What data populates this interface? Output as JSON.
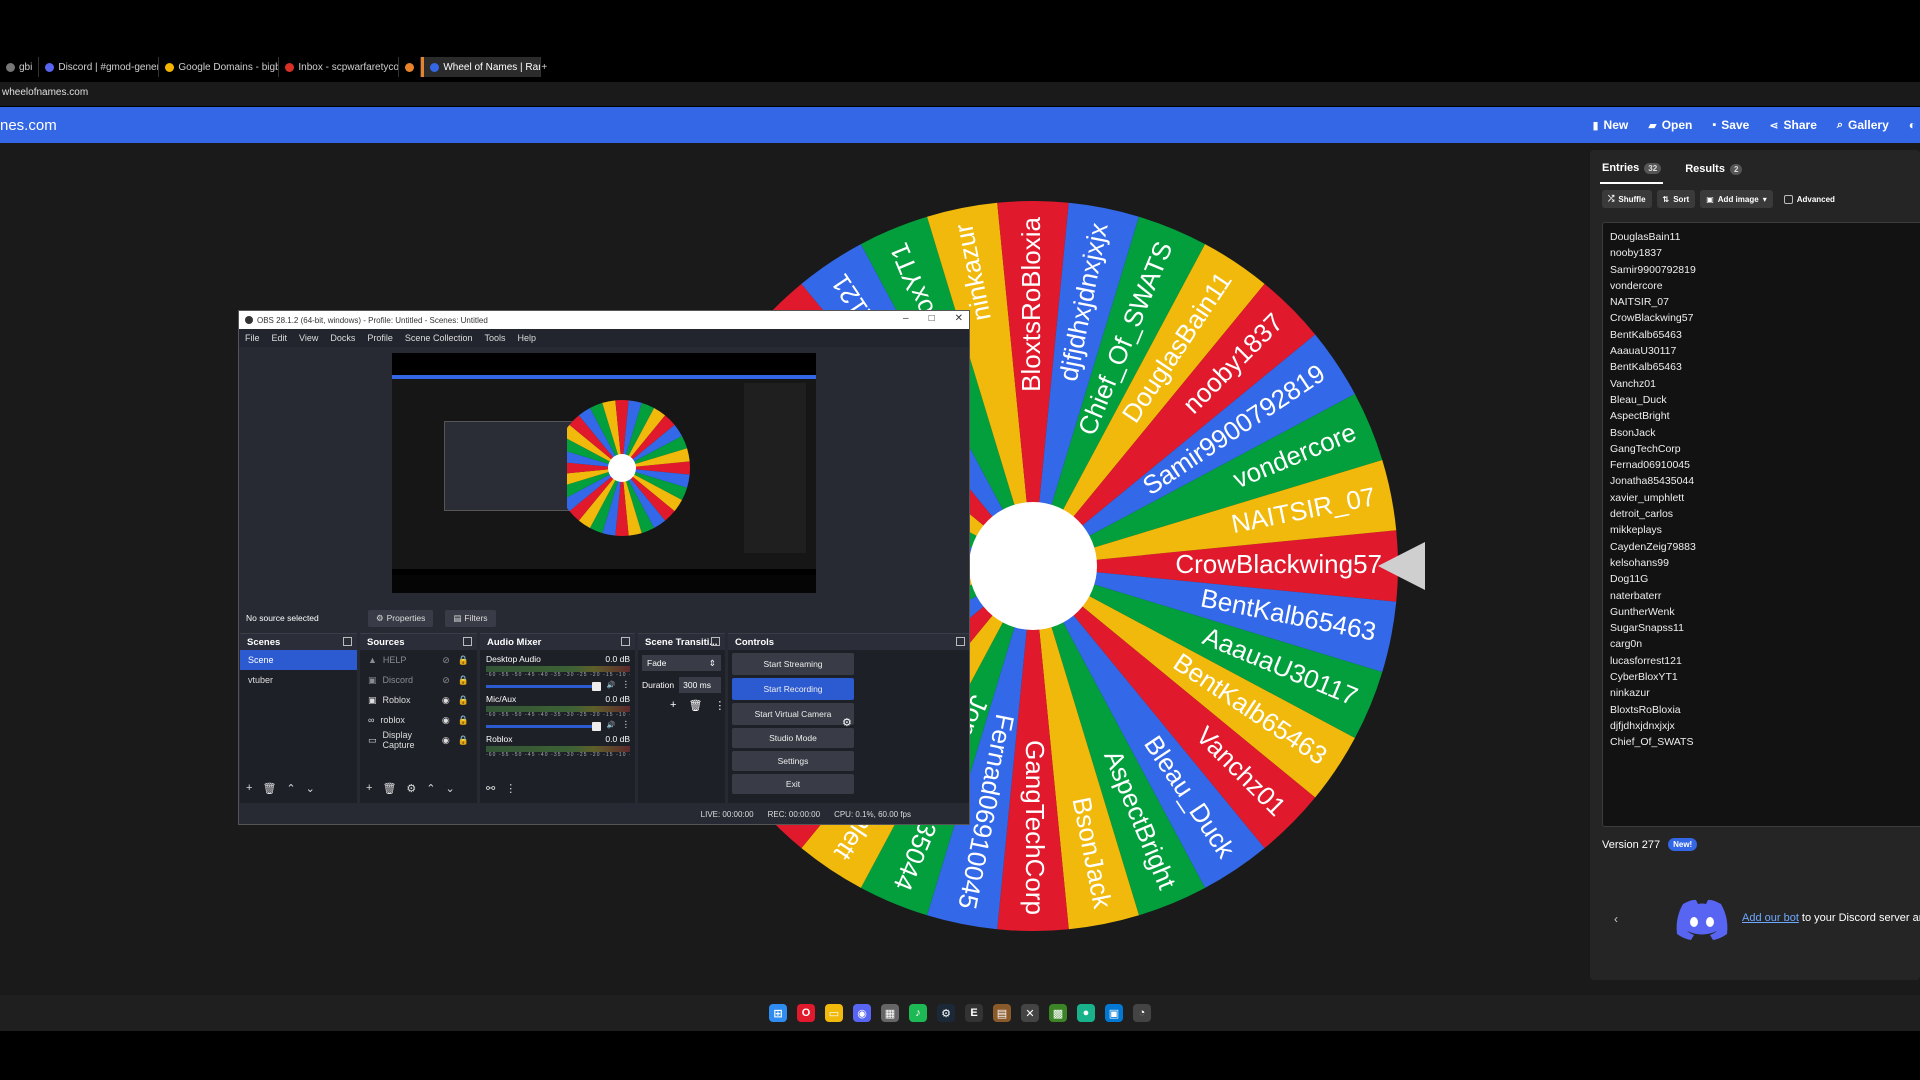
{
  "browser": {
    "tabs": [
      {
        "label": "gbi",
        "color": "#777"
      },
      {
        "label": "Discord | #gmod-general",
        "color": "#5865f2"
      },
      {
        "label": "Google Domains - bigbr",
        "color": "#f4b400"
      },
      {
        "label": "Inbox - scpwarfaretycoon",
        "color": "#d93025"
      },
      {
        "label": "",
        "color": "#e8822b"
      },
      {
        "label": "Wheel of Names | Random",
        "color": "#3367e6"
      }
    ],
    "new_tab": "+",
    "address": "wheelofnames.com"
  },
  "site": {
    "name": "nes.com",
    "nav": [
      {
        "label": "New",
        "icon": "file-icon"
      },
      {
        "label": "Open",
        "icon": "folder-icon"
      },
      {
        "label": "Save",
        "icon": "save-icon"
      },
      {
        "label": "Share",
        "icon": "share-icon"
      },
      {
        "label": "Gallery",
        "icon": "search-icon"
      }
    ],
    "colors": {
      "header": "#3367e6",
      "red": "#e0192c",
      "blue": "#3369e8",
      "green": "#029f3c",
      "yellow": "#f0b90c"
    }
  },
  "wheel": {
    "segments": [
      "CrowBlackwing57",
      "BentKalb65463",
      "AaauaU30117",
      "BentKalb65463",
      "Vanchz01",
      "Bleau_Duck",
      "AspectBright",
      "BsonJack",
      "GangTechCorp",
      "Fernad06910045",
      "Jonatha85435044",
      "xavier_umphlett",
      "detroit_carlos",
      "mikkeplays",
      "CaydenZeig79883",
      "kelsohans99",
      "Dog11G",
      "naterbaterr",
      "GuntherWenk",
      "SugarSnapss11",
      "carg0n",
      "lucasforrest121",
      "CyberBloxYT1",
      "ninkazur",
      "BloxtsRoBloxia",
      "djfjdhxjdnxjxjx",
      "Chief_Of_SWATS",
      "DouglasBain11",
      "nooby1837",
      "Samir9900792819",
      "vondercore",
      "NAITSIR_07"
    ]
  },
  "panel": {
    "tabs": [
      {
        "label": "Entries",
        "count": "32"
      },
      {
        "label": "Results",
        "count": "2"
      }
    ],
    "tools": {
      "shuffle": "Shuffle",
      "sort": "Sort",
      "add_image": "Add image",
      "advanced": "Advanced"
    },
    "entries": [
      "DouglasBain11",
      "nooby1837",
      "Samir9900792819",
      "vondercore",
      "NAITSIR_07",
      "CrowBlackwing57",
      "BentKalb65463",
      "AaauaU30117",
      "BentKalb65463",
      "Vanchz01",
      "Bleau_Duck",
      "AspectBright",
      "BsonJack",
      "GangTechCorp",
      "Fernad06910045",
      "Jonatha85435044",
      "xavier_umphlett",
      "detroit_carlos",
      "mikkeplays",
      "CaydenZeig79883",
      "kelsohans99",
      "Dog11G",
      "naterbaterr",
      "GuntherWenk",
      "SugarSnapss11",
      "carg0n",
      "lucasforrest121",
      "CyberBloxYT1",
      "ninkazur",
      "BloxtsRoBloxia",
      "djfjdhxjdnxjxjx",
      "Chief_Of_SWATS"
    ],
    "version": "Version 277",
    "new_badge": "New!",
    "discord_link": "Add our bot",
    "discord_text": " to your Discord server ar"
  },
  "obs": {
    "title": "OBS 28.1.2 (64-bit, windows) - Profile: Untitled - Scenes: Untitled",
    "menu": [
      "File",
      "Edit",
      "View",
      "Docks",
      "Profile",
      "Scene Collection",
      "Tools",
      "Help"
    ],
    "no_source": "No source selected",
    "properties": "Properties",
    "filters": "Filters",
    "docks": {
      "scenes": "Scenes",
      "sources": "Sources",
      "mixer": "Audio Mixer",
      "transitions": "Scene Transiti...",
      "controls": "Controls"
    },
    "scenes": [
      "Scene",
      "vtuber"
    ],
    "sources": [
      {
        "label": "HELP",
        "dim": true
      },
      {
        "label": "Discord",
        "dim": true
      },
      {
        "label": "Roblox",
        "dim": false
      },
      {
        "label": "roblox",
        "dim": false
      },
      {
        "label": "Display Capture",
        "dim": false
      }
    ],
    "mixer": [
      {
        "name": "Desktop Audio",
        "db": "0.0 dB"
      },
      {
        "name": "Mic/Aux",
        "db": "0.0 dB"
      },
      {
        "name": "Roblox",
        "db": "0.0 dB"
      }
    ],
    "ticks": "-60 -55 -50 -45 -40 -35 -30 -25 -20 -15 -10 -5 0",
    "transition": {
      "type": "Fade",
      "duration_label": "Duration",
      "duration": "300 ms"
    },
    "controls": [
      "Start Streaming",
      "Start Recording",
      "Start Virtual Camera",
      "Studio Mode",
      "Settings",
      "Exit"
    ],
    "status": {
      "live": "LIVE: 00:00:00",
      "rec": "REC: 00:00:00",
      "cpu": "CPU: 0.1%, 60.00 fps"
    }
  },
  "taskbar": [
    "windows-icon",
    "opera-icon",
    "explorer-icon",
    "discord-icon",
    "calendar-icon",
    "spotify-icon",
    "steam-icon",
    "epic-icon",
    "chest-icon",
    "x-icon",
    "minecraft-icon",
    "app-icon",
    "store-icon",
    "obs-icon"
  ]
}
